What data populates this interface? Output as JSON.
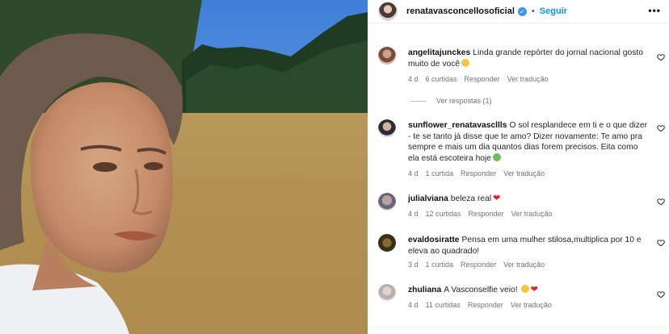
{
  "post": {
    "username": "renatavasconcellosoficial",
    "follow_label": "Seguir",
    "separator": "•",
    "more": "•••"
  },
  "comments": [
    {
      "username": "angelitajunckes",
      "text": "Linda grande repórter do jornal nacional gosto muito de você",
      "time": "4 d",
      "likes": "6 curtidas",
      "reply": "Responder",
      "translate": "Ver tradução"
    },
    {
      "username": "sunflower_renatavascllls",
      "text": "O sol resplandece em ti e o que dizer - te se tanto já disse que te amo? Dizer novamente: Te amo pra sempre e mais um dia quantos dias forem precisos. Eita como ela está escoteira hoje",
      "time": "4 d",
      "likes": "1 curtida",
      "reply": "Responder",
      "translate": "Ver tradução"
    },
    {
      "username": "julialviana",
      "text": "beleza real",
      "time": "4 d",
      "likes": "12 curtidas",
      "reply": "Responder",
      "translate": "Ver tradução"
    },
    {
      "username": "evaldosiratte",
      "text": "Pensa em uma mulher stilosa,multiplica por 10 e eleva ao quadrado!",
      "time": "3 d",
      "likes": "1 curtida",
      "reply": "Responder",
      "translate": "Ver tradução"
    },
    {
      "username": "zhuliana",
      "text": "A Vasconselfie veio!",
      "time": "4 d",
      "likes": "11 curtidas",
      "reply": "Responder",
      "translate": "Ver tradução"
    }
  ],
  "view_replies": "Ver respostas (1)",
  "icons": {
    "verified": "verified-badge-icon",
    "like": "heart-outline-icon",
    "more": "more-options-icon"
  },
  "colors": {
    "follow": "#0095f6",
    "verified": "#3897f0",
    "meta": "#737373"
  }
}
